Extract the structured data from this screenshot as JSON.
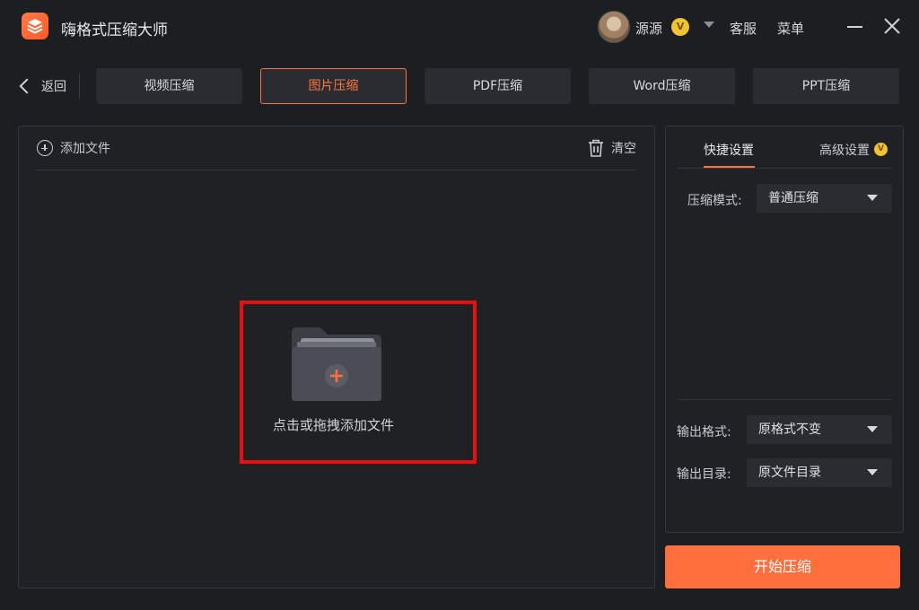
{
  "window": {
    "title": "嗨格式压缩大师",
    "user_name": "源源",
    "vip_badge": "V",
    "support_label": "客服",
    "menu_label": "菜单"
  },
  "nav": {
    "back_label": "返回",
    "tabs": [
      {
        "label": "视频压缩",
        "active": false
      },
      {
        "label": "图片压缩",
        "active": true
      },
      {
        "label": "PDF压缩",
        "active": false
      },
      {
        "label": "Word压缩",
        "active": false
      },
      {
        "label": "PPT压缩",
        "active": false
      }
    ]
  },
  "file_panel": {
    "add_file_label": "添加文件",
    "clear_label": "清空",
    "drop_text": "点击或拖拽添加文件"
  },
  "settings_panel": {
    "tabs": [
      {
        "label": "快捷设置",
        "active": true
      },
      {
        "label": "高级设置",
        "active": false
      }
    ],
    "advanced_badge": "V",
    "compress_mode": {
      "label": "压缩模式:",
      "value": "普通压缩"
    },
    "output_format": {
      "label": "输出格式:",
      "value": "原格式不变"
    },
    "output_dir": {
      "label": "输出目录:",
      "value": "原文件目录"
    }
  },
  "start_button_label": "开始压缩",
  "colors": {
    "accent": "#ff6e3d",
    "background": "#1c1e22",
    "panel": "#1f2125",
    "highlight_box": "#ea0f0f",
    "vip_gold": "#f1c232"
  }
}
